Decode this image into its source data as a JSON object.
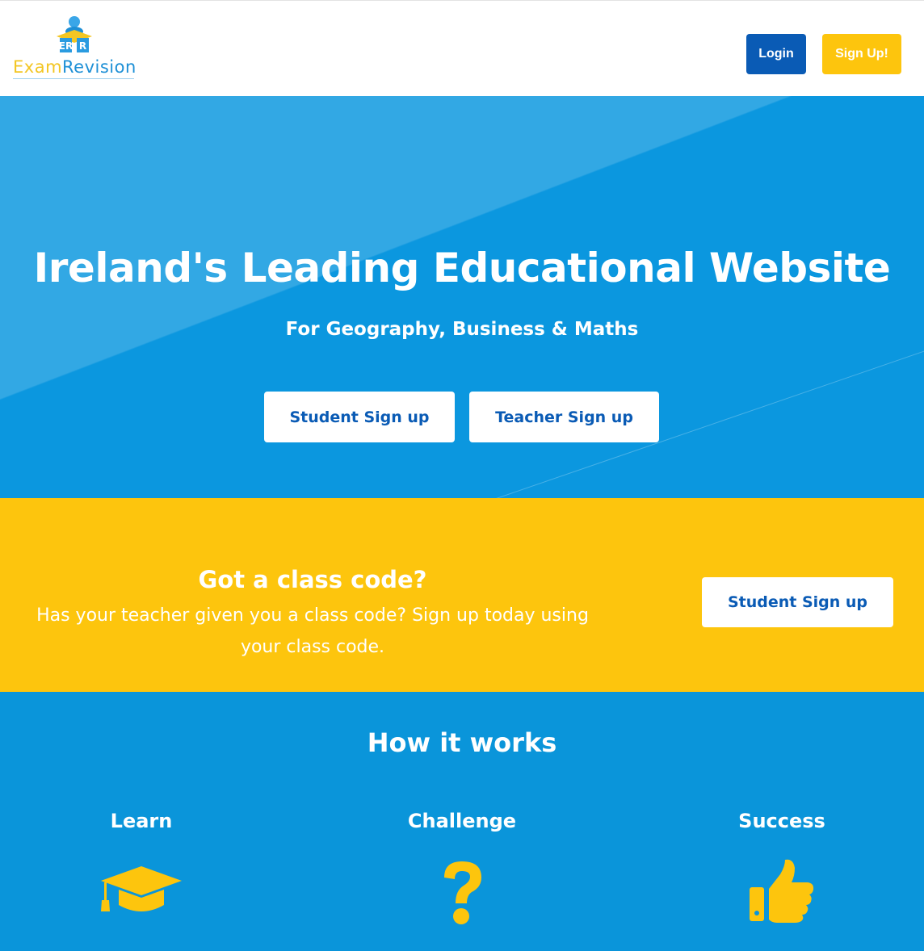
{
  "header": {
    "logo": {
      "part1": "Exam",
      "part2": "Revision",
      "badge_text": "ER"
    },
    "login_label": "Login",
    "signup_label": "Sign Up!"
  },
  "hero": {
    "title": "Ireland's Leading Educational Website",
    "subtitle": "For Geography, Business & Maths",
    "student_signup_label": "Student Sign up",
    "teacher_signup_label": "Teacher Sign up"
  },
  "class_code": {
    "title": "Got a class code?",
    "text": "Has your teacher given you a class code? Sign up today using your class code.",
    "button_label": "Student Sign up"
  },
  "how_it_works": {
    "title": "How it works",
    "steps": [
      {
        "label": "Learn",
        "icon": "graduation-cap-icon"
      },
      {
        "label": "Challenge",
        "icon": "question-mark-icon"
      },
      {
        "label": "Success",
        "icon": "thumbs-up-icon"
      }
    ]
  },
  "colors": {
    "blue": "#0a95da",
    "dark_blue": "#0a5bb5",
    "yellow": "#fdc50d",
    "white": "#ffffff"
  }
}
